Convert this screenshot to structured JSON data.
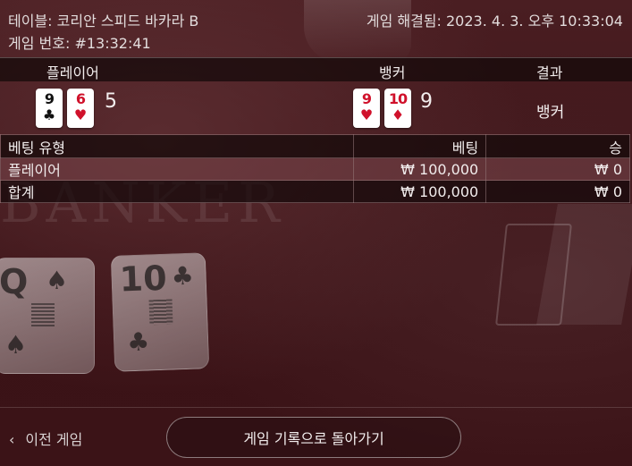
{
  "header": {
    "table_name": "테이블: 코리안 스피드 바카라 B",
    "game_number": "게임 번호: #13:32:41",
    "resolved_time": "게임 해결됨: 2023. 4. 3. 오후 10:33:04"
  },
  "result_table": {
    "columns": [
      "플레이어",
      "뱅커",
      "결과"
    ],
    "player": {
      "cards": [
        {
          "rank": "9",
          "suit": "♣",
          "color": "#111111"
        },
        {
          "rank": "6",
          "suit": "♥",
          "color": "#d0112b"
        }
      ],
      "score": "5"
    },
    "banker": {
      "cards": [
        {
          "rank": "9",
          "suit": "♥",
          "color": "#d0112b"
        },
        {
          "rank": "10",
          "suit": "♦",
          "color": "#d0112b"
        }
      ],
      "score": "9"
    },
    "result": "뱅커"
  },
  "bet_table": {
    "headers": [
      "베팅 유형",
      "베팅",
      "승"
    ],
    "rows": [
      {
        "type": "플레이어",
        "bet": "₩ 100,000",
        "win": "₩ 0"
      },
      {
        "type": "합계",
        "bet": "₩ 100,000",
        "win": "₩ 0"
      }
    ]
  },
  "footer": {
    "prev_game": "이전 게임",
    "back_button": "게임 기록으로 돌아가기"
  },
  "background": {
    "word": "BANKER",
    "card_left": {
      "rank": "Q",
      "suit": "♠"
    },
    "card_right": {
      "rank": "10",
      "suit": "♣"
    }
  },
  "colors": {
    "background": "#3d1317",
    "red_suit": "#d0112b",
    "black_suit": "#111111"
  }
}
